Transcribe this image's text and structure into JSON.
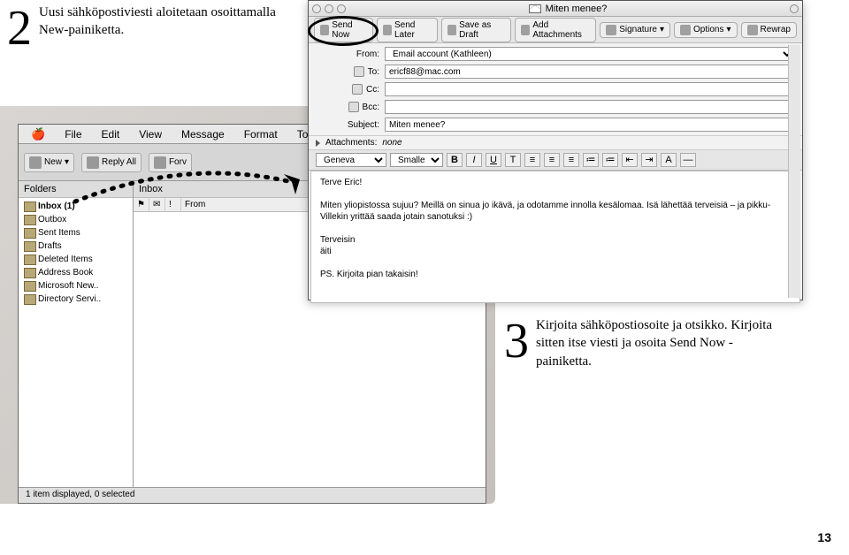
{
  "callouts": {
    "two": {
      "number": "2",
      "text": "Uusi sähköpostiviesti aloitetaan osoittamalla New-painiketta."
    },
    "three": {
      "number": "3",
      "text": "Kirjoita sähköpostiosoite ja otsikko. Kirjoita sitten itse viesti ja osoita Send Now -painiketta."
    }
  },
  "page_number": "13",
  "main_app": {
    "menu": {
      "file": "File",
      "edit": "Edit",
      "view": "View",
      "message": "Message",
      "format": "Format",
      "tools": "Tools"
    },
    "toolbar": {
      "new": "New",
      "reply_all": "Reply All",
      "forward": "Forv"
    },
    "folder_pane_title": "Folders",
    "folders": [
      "Inbox (1)",
      "Outbox",
      "Sent Items",
      "Drafts",
      "Deleted Items",
      "Address Book",
      "Microsoft New..",
      "Directory Servi.."
    ],
    "inbox_title": "Inbox",
    "cols": [
      "From"
    ],
    "status": "1 item displayed, 0 selected"
  },
  "compose": {
    "title": "Miten menee?",
    "toolbar": {
      "send_now": "Send Now",
      "send_later": "Send Later",
      "save_draft": "Save as Draft",
      "add_attach": "Add Attachments",
      "signature": "Signature",
      "options": "Options",
      "rewrap": "Rewrap"
    },
    "headers": {
      "from_label": "From:",
      "from_value": "Email account (Kathleen)",
      "to_label": "To:",
      "to_value": "ericf88@mac.com",
      "cc_label": "Cc:",
      "bcc_label": "Bcc:",
      "subject_label": "Subject:",
      "subject_value": "Miten menee?",
      "attachments_label": "Attachments:",
      "attachments_value": "none"
    },
    "format": {
      "font": "Geneva",
      "size": "Smaller"
    },
    "body": {
      "l1": "Terve Eric!",
      "l2": "Miten yliopistossa sujuu? Meillä on sinua jo ikävä, ja odotamme innolla kesälomaa. Isä lähettää terveisiä – ja pikku-Villekin yrittää saada jotain sanotuksi :)",
      "l3": "Terveisin",
      "l4": "äiti",
      "l5": "PS. Kirjoita pian takaisin!"
    }
  }
}
